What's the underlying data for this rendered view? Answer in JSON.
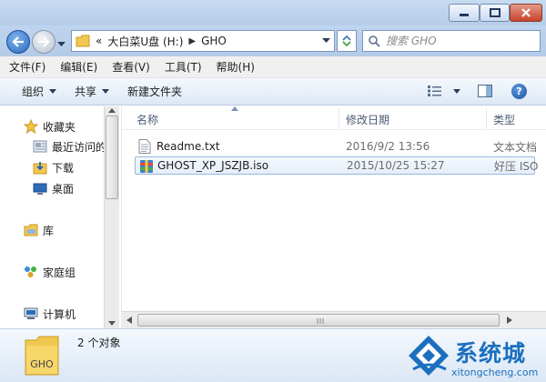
{
  "window": {
    "controls": [
      "minimize",
      "maximize",
      "close"
    ]
  },
  "address": {
    "prefix": "«",
    "drive": "大白菜U盘 (H:)",
    "folder": "GHO"
  },
  "search": {
    "placeholder": "搜索 GHO"
  },
  "menu": [
    "文件(F)",
    "编辑(E)",
    "查看(V)",
    "工具(T)",
    "帮助(H)"
  ],
  "commands": {
    "organize": "组织",
    "share": "共享",
    "new_folder": "新建文件夹"
  },
  "nav": {
    "favorites": "收藏夹",
    "recent": "最近访问的",
    "downloads": "下载",
    "desktop": "桌面",
    "libraries": "库",
    "homegroup": "家庭组",
    "computer": "计算机"
  },
  "columns": {
    "name": "名称",
    "date": "修改日期",
    "type": "类型"
  },
  "files": [
    {
      "name": "Readme.txt",
      "date": "2016/9/2 13:56",
      "type": "文本文档",
      "icon": "text-file-icon"
    },
    {
      "name": "GHOST_XP_JSZJB.iso",
      "date": "2015/10/25 15:27",
      "type": "好压 ISO",
      "icon": "archive-file-icon"
    }
  ],
  "status": {
    "count": "2 个对象",
    "folder_icon_label": "GHO"
  },
  "watermark": {
    "brand": "系统城",
    "site": "xitongcheng.com"
  },
  "colors": {
    "accent": "#1c6fbf",
    "selection": "#e5eefa"
  }
}
